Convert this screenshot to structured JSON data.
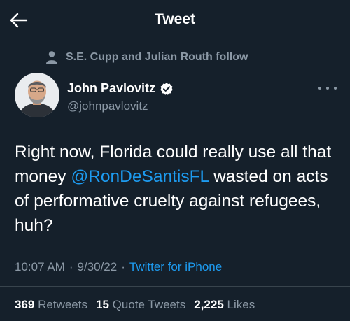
{
  "header": {
    "title": "Tweet",
    "back_icon": "arrow-left-icon"
  },
  "social_context": {
    "text": "S.E. Cupp and Julian Routh follow",
    "icon": "person-icon"
  },
  "author": {
    "name": "John Pavlovitz",
    "handle": "@johnpavlovitz",
    "verified": true
  },
  "tweet": {
    "text_before": "Right now, Florida could really use all that money ",
    "mention": "@RonDeSantisFL",
    "text_after": " wasted on acts of performative cruelty against refugees, huh?"
  },
  "meta": {
    "time": "10:07 AM",
    "separator": "·",
    "date": "9/30/22",
    "source": "Twitter for iPhone"
  },
  "stats": {
    "retweets_count": "369",
    "retweets_label": "Retweets",
    "quotes_count": "15",
    "quotes_label": "Quote Tweets",
    "likes_count": "2,225",
    "likes_label": "Likes"
  },
  "colors": {
    "background": "#15202b",
    "accent": "#1d9bf0",
    "secondary_text": "#8b98a5"
  }
}
